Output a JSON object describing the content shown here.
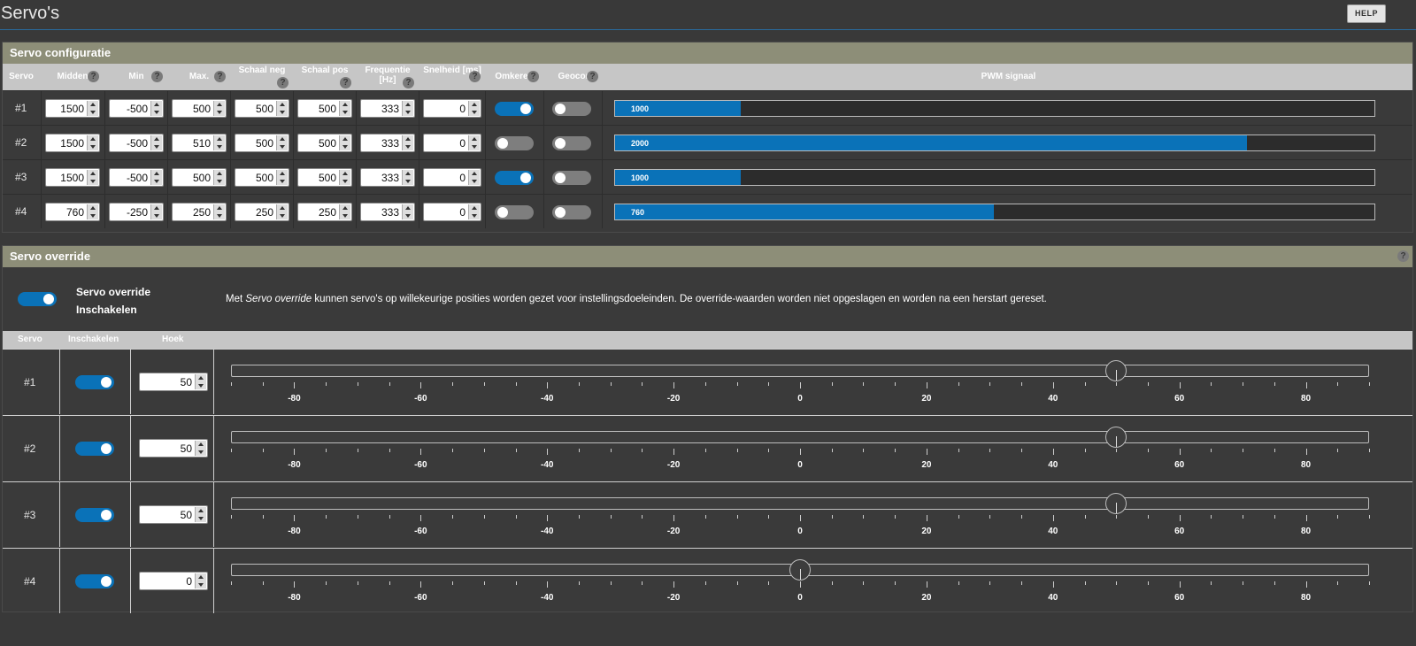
{
  "header": {
    "title": "Servo's",
    "help_label": "HELP"
  },
  "config": {
    "title": "Servo configuratie",
    "columns": [
      {
        "key": "servo",
        "label": "Servo",
        "line2": ""
      },
      {
        "key": "mid",
        "label": "Midden",
        "line2": ""
      },
      {
        "key": "min",
        "label": "Min",
        "line2": ""
      },
      {
        "key": "max",
        "label": "Max.",
        "line2": ""
      },
      {
        "key": "rateneg",
        "label": "Schaal neg",
        "line2": ""
      },
      {
        "key": "ratepos",
        "label": "Schaal pos",
        "line2": ""
      },
      {
        "key": "freq",
        "label": "Frequentie",
        "line2": "[Hz]"
      },
      {
        "key": "speed",
        "label": "Snelheid [ms]",
        "line2": ""
      },
      {
        "key": "reverse",
        "label": "Omkeren",
        "line2": ""
      },
      {
        "key": "geocor",
        "label": "Geocor",
        "line2": ""
      },
      {
        "key": "pwm",
        "label": "PWM signaal",
        "line2": ""
      }
    ],
    "pwm_max": 2000,
    "rows": [
      {
        "label": "#1",
        "mid": "1500",
        "min": "-500",
        "max": "500",
        "rateneg": "500",
        "ratepos": "500",
        "freq": "333",
        "speed": "0",
        "reverse": true,
        "geocor": false,
        "pwm": 1000
      },
      {
        "label": "#2",
        "mid": "1500",
        "min": "-500",
        "max": "510",
        "rateneg": "500",
        "ratepos": "500",
        "freq": "333",
        "speed": "0",
        "reverse": false,
        "geocor": false,
        "pwm": 2000
      },
      {
        "label": "#3",
        "mid": "1500",
        "min": "-500",
        "max": "500",
        "rateneg": "500",
        "ratepos": "500",
        "freq": "333",
        "speed": "0",
        "reverse": true,
        "geocor": false,
        "pwm": 1000
      },
      {
        "label": "#4",
        "mid": "760",
        "min": "-250",
        "max": "250",
        "rateneg": "250",
        "ratepos": "250",
        "freq": "333",
        "speed": "0",
        "reverse": false,
        "geocor": false,
        "pwm": 760
      }
    ]
  },
  "override": {
    "title": "Servo override",
    "toggle_label_1": "Servo override",
    "toggle_label_2": "Inschakelen",
    "enabled": true,
    "desc_prefix": "Met ",
    "desc_em": "Servo override",
    "desc_suffix": " kunnen servo's op willekeurige posities worden gezet voor instellingsdoeleinden. De override-waarden worden niet opgeslagen en worden na een herstart gereset.",
    "columns": {
      "servo": "Servo",
      "enable": "Inschakelen",
      "angle": "Hoek"
    },
    "slider_min": -90,
    "slider_max": 90,
    "tick_labels": [
      "-80",
      "-60",
      "-40",
      "-20",
      "0",
      "20",
      "40",
      "60",
      "80"
    ],
    "rows": [
      {
        "label": "#1",
        "enabled": true,
        "angle": "50",
        "value": 50
      },
      {
        "label": "#2",
        "enabled": true,
        "angle": "50",
        "value": 50
      },
      {
        "label": "#3",
        "enabled": true,
        "angle": "50",
        "value": 50
      },
      {
        "label": "#4",
        "enabled": true,
        "angle": "0",
        "value": 0
      }
    ]
  },
  "colors": {
    "accent": "#0a72b8",
    "panel_header": "#8d8e78",
    "background": "#393939"
  }
}
